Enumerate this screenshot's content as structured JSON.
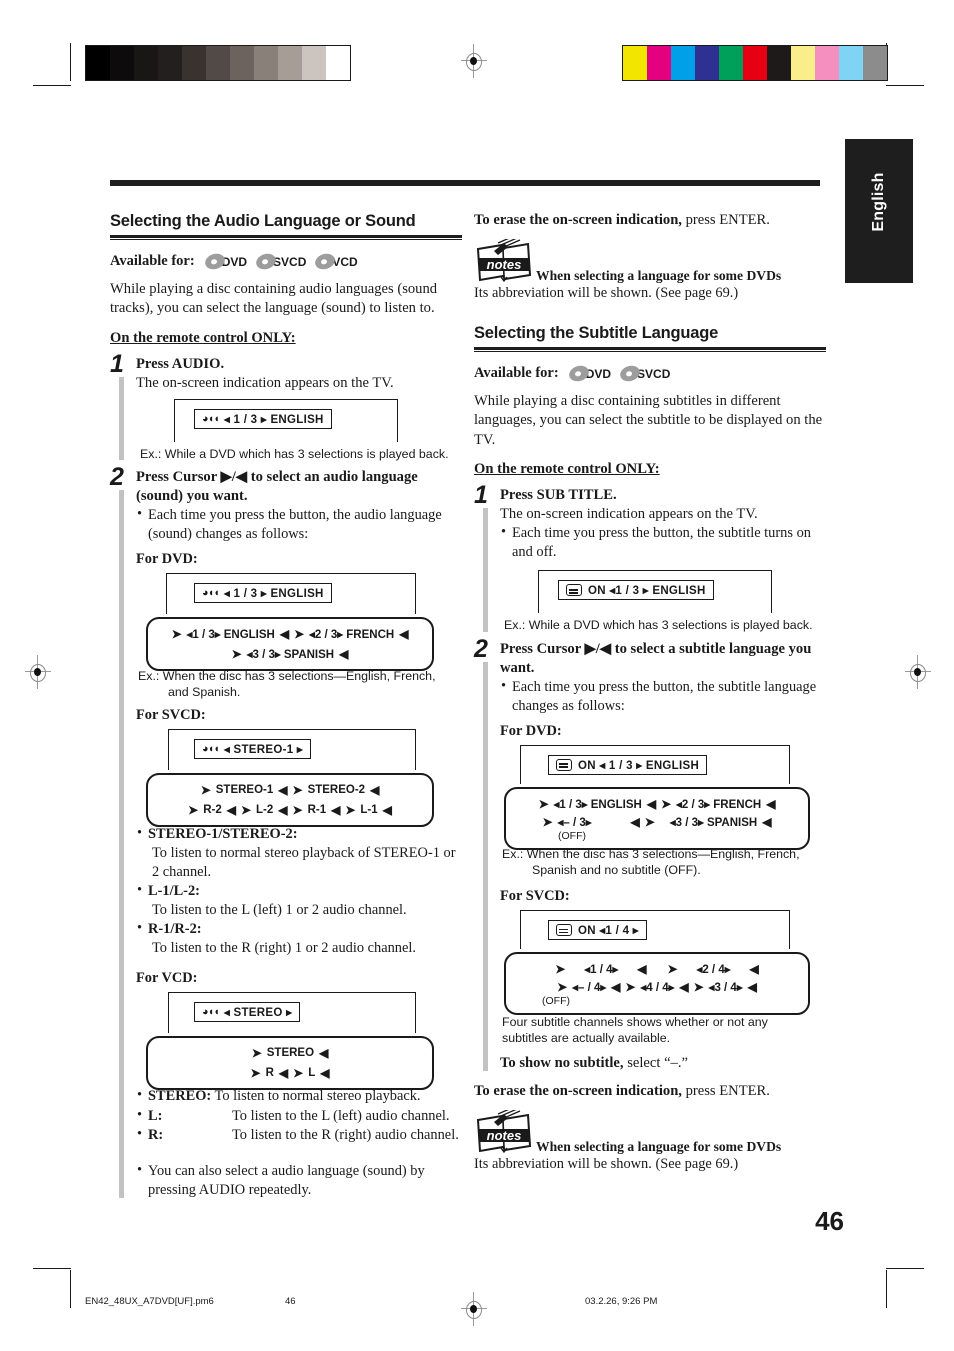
{
  "sidebar": {
    "language_tab": "English"
  },
  "page": {
    "number": "46"
  },
  "registration": {
    "gray_swatches": [
      "#000000",
      "#0d0b0b",
      "#191616",
      "#241f1f",
      "#39322f",
      "#524a46",
      "#6d635e",
      "#8a807a",
      "#a79d97",
      "#cbc4bf",
      "#ffffff"
    ],
    "color_swatches": [
      "#f2e500",
      "#e5007f",
      "#00a0e9",
      "#2e3192",
      "#00a05a",
      "#e60012",
      "#1e1a1a",
      "#faee8a",
      "#f48fc0",
      "#7fd4f5",
      "#8c8c8c"
    ]
  },
  "left_column": {
    "heading": "Selecting the Audio Language or Sound",
    "available_label": "Available for:",
    "available_discs": [
      "DVD",
      "SVCD",
      "VCD"
    ],
    "intro": "While playing a disc containing audio languages (sound tracks), you can select the language (sound) to listen to.",
    "remote_note": "On the remote control ONLY:",
    "step1": {
      "num": "1",
      "title": "Press AUDIO.",
      "desc": "The on-screen indication appears on the TV.",
      "osd_icon": "audio-track-icon",
      "osd_text": "◂ 1 / 3 ▸ ENGLISH",
      "example": "Ex.: While a DVD which has 3 selections is played back."
    },
    "step2": {
      "num": "2",
      "title_line1": "Press Cursor ▶/◀ to select an audio language",
      "title_line2": "(sound) you want.",
      "bullet": "Each time you press the button, the audio language (sound) changes as follows:",
      "dvd": {
        "label": "For DVD:",
        "osd_text": "◂ 1 / 3 ▸ ENGLISH",
        "cycle_row1": [
          "◂1 / 3▸ ENGLISH",
          "◂2 / 3▸ FRENCH"
        ],
        "cycle_row2": [
          "◂3 / 3▸ SPANISH"
        ],
        "example_line1": "Ex.: When the disc has 3 selections—English, French,",
        "example_line2": "and Spanish."
      },
      "svcd": {
        "label": "For SVCD:",
        "osd_text": "◂ STEREO-1 ▸",
        "cycle_row1": [
          "STEREO-1",
          "STEREO-2"
        ],
        "cycle_row2": [
          "R-2",
          "L-2",
          "R-1",
          "L-1"
        ]
      },
      "svcd_defs": [
        {
          "term": "STEREO-1/STEREO-2:",
          "def": "To listen to normal stereo playback of STEREO-1 or 2 channel."
        },
        {
          "term": "L-1/L-2:",
          "def": "To listen to the L (left) 1 or 2 audio channel."
        },
        {
          "term": "R-1/R-2:",
          "def": "To listen to the R (right) 1 or 2 audio channel."
        }
      ],
      "vcd": {
        "label": "For VCD:",
        "osd_text": "◂ STEREO   ▸",
        "cycle_row1": [
          "STEREO"
        ],
        "cycle_row2": [
          "R",
          "L"
        ]
      },
      "vcd_defs": [
        {
          "term": "STEREO:",
          "def": "To listen to normal stereo playback."
        },
        {
          "term": "L:",
          "def": "To listen to the L (left) audio channel."
        },
        {
          "term": "R:",
          "def": "To listen to the R (right) audio channel."
        }
      ],
      "final_bullet": "You can also select a audio language (sound) by pressing AUDIO repeatedly."
    }
  },
  "right_column": {
    "erase_bold": "To erase the on-screen indication,",
    "erase_rest": " press ENTER.",
    "notes_top": {
      "icon": "notes-icon",
      "icon_label": "notes",
      "heading": "When selecting a language for some DVDs",
      "body": "Its abbreviation will be shown. (See page 69.)"
    },
    "heading": "Selecting the Subtitle Language",
    "available_label": "Available for:",
    "available_discs": [
      "DVD",
      "SVCD"
    ],
    "intro": "While playing a disc containing subtitles in different languages, you can select the subtitle to be displayed on the TV.",
    "remote_note": "On the remote control ONLY:",
    "step1": {
      "num": "1",
      "title": "Press SUB TITLE.",
      "desc": "The on-screen indication appears on the TV.",
      "bullet": "Each time you press the button, the subtitle turns on and off.",
      "osd_icon": "subtitle-icon",
      "osd_text": "ON     ◂1 / 3 ▸ ENGLISH",
      "example": "Ex.: While a DVD which has 3 selections is played back."
    },
    "step2": {
      "num": "2",
      "title_line1": "Press Cursor ▶/◀ to select a subtitle language you",
      "title_line2": "want.",
      "bullet": "Each time you press the button, the subtitle language changes as follows:",
      "dvd": {
        "label": "For DVD:",
        "osd_text": "ON     ◂ 1 / 3 ▸ ENGLISH",
        "cycle_row1": [
          "◂1 / 3▸ ENGLISH",
          "◂2 / 3▸ FRENCH"
        ],
        "cycle_row2_left": "◂– / 3▸",
        "cycle_row2_left_sub": "(OFF)",
        "cycle_row2_right": "◂3 / 3▸ SPANISH",
        "example_line1": "Ex.: When the disc has 3 selections—English, French,",
        "example_line2": "Spanish and no subtitle (OFF)."
      },
      "svcd": {
        "label": "For SVCD:",
        "osd_text": "ON     ◂1 / 4 ▸",
        "cycle_row1": [
          "◂1 / 4▸",
          "◂2 / 4▸"
        ],
        "cycle_row2": [
          "◂– / 4▸",
          "◂4 / 4▸",
          "◂3 / 4▸"
        ],
        "cycle_row2_sub": "(OFF)",
        "note_line1": "Four subtitle channels shows whether or not any",
        "note_line2": "subtitles are actually available."
      },
      "no_subtitle_bold": "To show no subtitle,",
      "no_subtitle_rest": " select “–.”"
    },
    "erase_bold2": "To erase the on-screen indication,",
    "erase_rest2": " press ENTER.",
    "notes_bottom": {
      "icon": "notes-icon",
      "icon_label": "notes",
      "heading": "When selecting a language for some DVDs",
      "body": "Its abbreviation will be shown. (See page 69.)"
    }
  },
  "footer": {
    "filename": "EN42_48UX_A7DVD[UF].pm6",
    "page": "46",
    "datetime": "03.2.26, 9:26 PM"
  }
}
